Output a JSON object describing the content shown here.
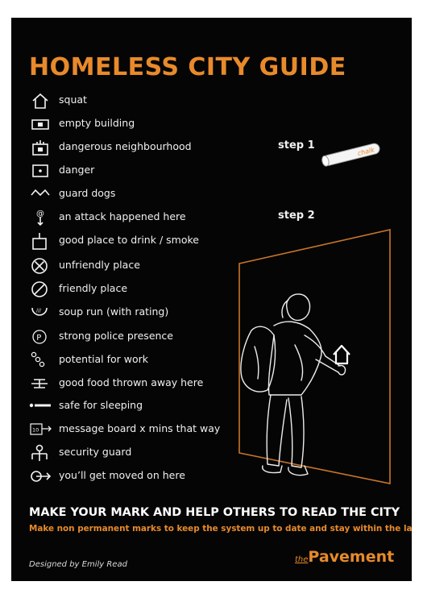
{
  "title": "HOMELESS CITY GUIDE",
  "symbols": [
    {
      "icon": "house-icon",
      "label": "squat"
    },
    {
      "icon": "empty-building-icon",
      "label": "empty building"
    },
    {
      "icon": "dangerous-neighbourhood-icon",
      "label": "dangerous neighbourhood"
    },
    {
      "icon": "danger-icon",
      "label": "danger"
    },
    {
      "icon": "guard-dogs-icon",
      "label": "guard dogs"
    },
    {
      "icon": "attack-icon",
      "label": "an attack happened here"
    },
    {
      "icon": "drink-smoke-icon",
      "label": "good place to drink / smoke"
    },
    {
      "icon": "circle-x-icon",
      "label": "unfriendly place"
    },
    {
      "icon": "circle-slash-icon",
      "label": "friendly place"
    },
    {
      "icon": "soup-run-icon",
      "label": "soup run (with rating)"
    },
    {
      "icon": "police-icon",
      "label": "strong police presence"
    },
    {
      "icon": "work-icon",
      "label": "potential for work"
    },
    {
      "icon": "food-icon",
      "label": "good food thrown away here"
    },
    {
      "icon": "sleeping-icon",
      "label": "safe for sleeping"
    },
    {
      "icon": "message-board-icon",
      "label": "message board x mins that way"
    },
    {
      "icon": "security-guard-icon",
      "label": "security guard"
    },
    {
      "icon": "moved-on-icon",
      "label": "you’ll get moved on here"
    }
  ],
  "steps": {
    "step1": "step 1",
    "step2": "step 2"
  },
  "chalk_label": "chalk",
  "message_board_number": "10",
  "soup_run_rating": "///",
  "police_letter": "P",
  "headline": "MAKE YOUR MARK AND HELP OTHERS TO READ THE CITY",
  "subline": "Make non permanent marks to keep the system up to date and stay within the law.",
  "credit": "Designed by Emily Read",
  "brand": {
    "the": "the",
    "name": "Pavement"
  },
  "colors": {
    "accent": "#e88a2b",
    "background": "#050505",
    "text": "#f2f2f2"
  }
}
